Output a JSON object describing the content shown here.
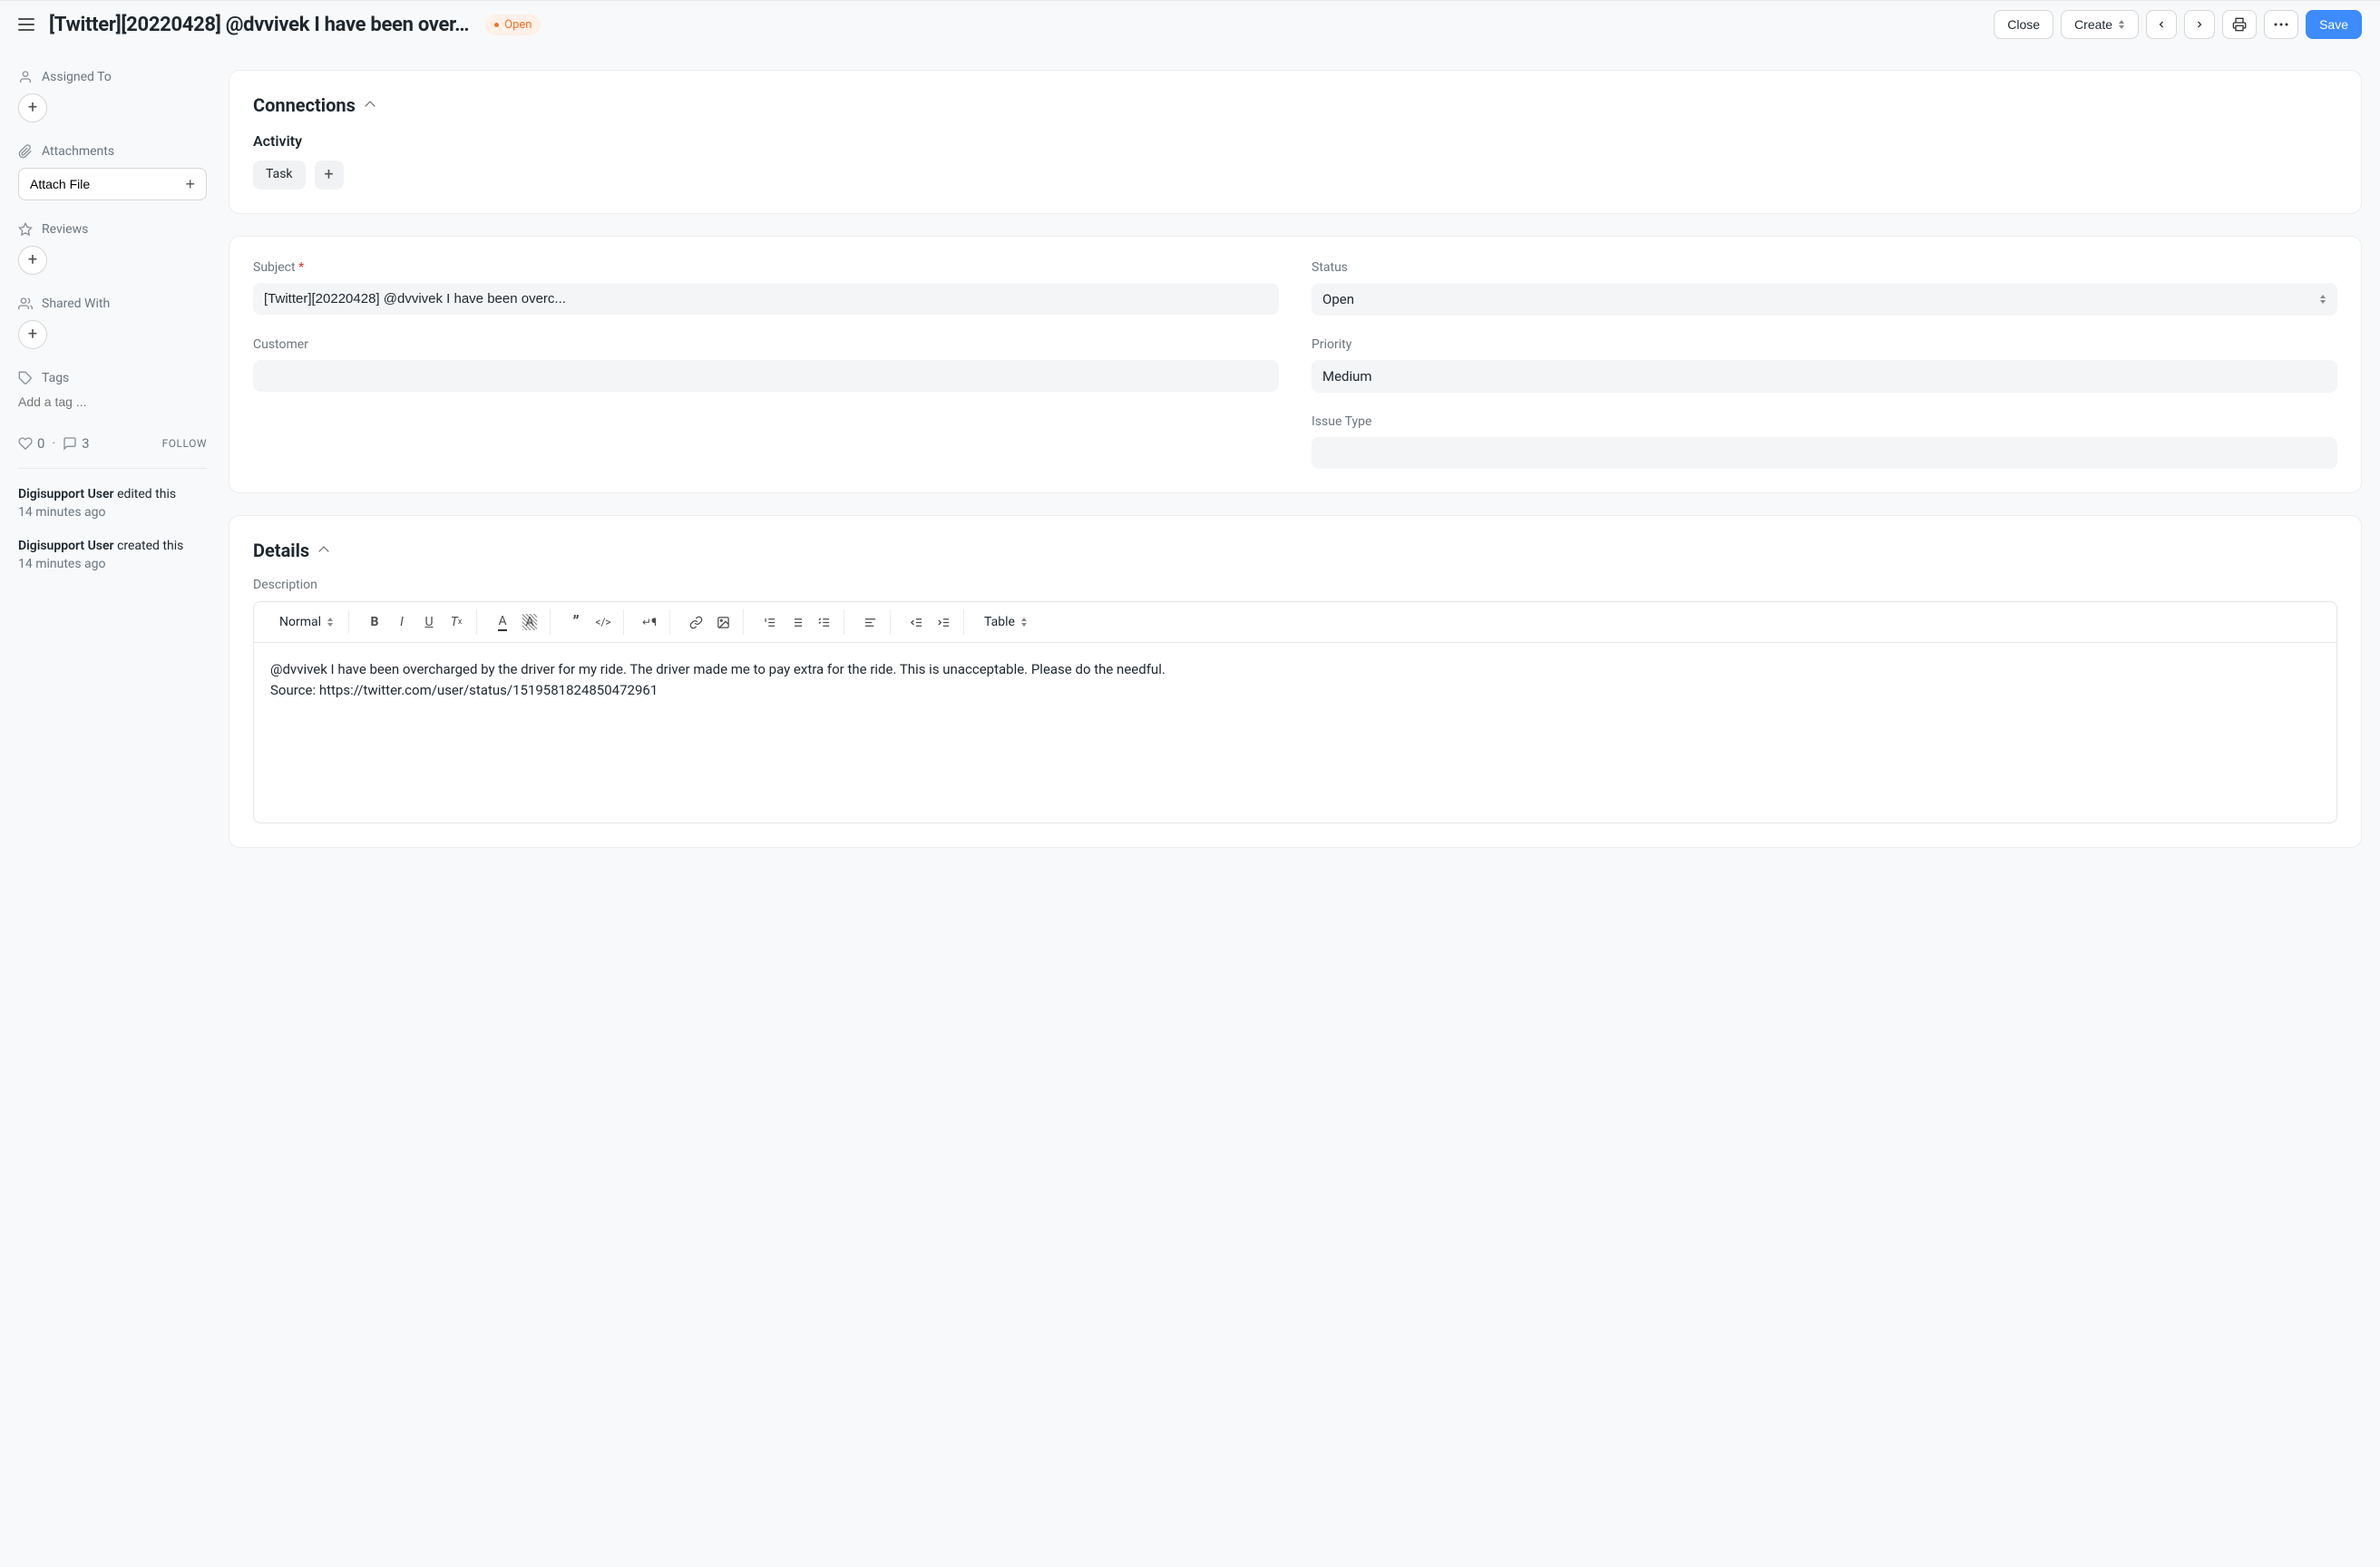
{
  "header": {
    "title": "[Twitter][20220428] @dvvivek I have been over…",
    "status_pill": "Open",
    "actions": {
      "close": "Close",
      "create": "Create",
      "save": "Save"
    }
  },
  "sidebar": {
    "assigned_to": {
      "label": "Assigned To"
    },
    "attachments": {
      "label": "Attachments",
      "button": "Attach File"
    },
    "reviews": {
      "label": "Reviews"
    },
    "shared_with": {
      "label": "Shared With"
    },
    "tags": {
      "label": "Tags",
      "placeholder": "Add a tag ..."
    },
    "stats": {
      "likes": "0",
      "comments": "3",
      "follow": "FOLLOW"
    },
    "activity": [
      {
        "user": "Digisupport User",
        "action": "edited this",
        "time": "14 minutes ago"
      },
      {
        "user": "Digisupport User",
        "action": "created this",
        "time": "14 minutes ago"
      }
    ]
  },
  "connections": {
    "title": "Connections",
    "activity_label": "Activity",
    "task_chip": "Task"
  },
  "form": {
    "subject": {
      "label": "Subject",
      "value": "[Twitter][20220428] @dvvivek I have been overc..."
    },
    "status": {
      "label": "Status",
      "value": "Open"
    },
    "customer": {
      "label": "Customer",
      "value": ""
    },
    "priority": {
      "label": "Priority",
      "value": "Medium"
    },
    "issue_type": {
      "label": "Issue Type",
      "value": ""
    }
  },
  "details": {
    "title": "Details",
    "description_label": "Description",
    "toolbar": {
      "style": "Normal",
      "table": "Table"
    },
    "description_body": "@dvvivek I have been overcharged by the driver for my ride. The driver made me to pay extra for the ride. This is unacceptable. Please do the needful.\nSource: https://twitter.com/user/status/1519581824850472961"
  }
}
